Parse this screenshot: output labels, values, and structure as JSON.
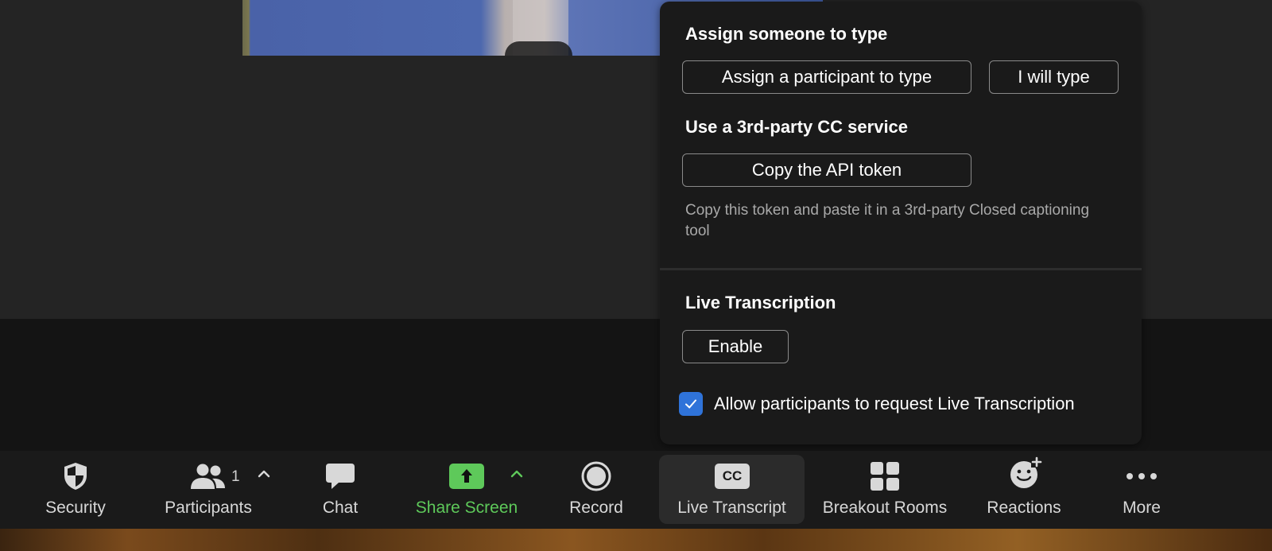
{
  "popover": {
    "assign_title": "Assign someone to type",
    "assign_participant_btn": "Assign a participant to type",
    "i_will_type_btn": "I will type",
    "third_party_title": "Use a 3rd-party CC service",
    "copy_token_btn": "Copy the API token",
    "copy_token_hint": "Copy this token and paste it in a 3rd-party Closed captioning tool",
    "live_title": "Live Transcription",
    "enable_btn": "Enable",
    "allow_request_label": "Allow participants to request Live Transcription",
    "allow_request_checked": true
  },
  "toolbar": {
    "security": "Security",
    "participants": "Participants",
    "participants_count": "1",
    "chat": "Chat",
    "share_screen": "Share Screen",
    "record": "Record",
    "live_transcript": "Live Transcript",
    "cc_badge": "CC",
    "breakout_rooms": "Breakout Rooms",
    "reactions": "Reactions",
    "more": "More"
  },
  "colors": {
    "share_green": "#5ec95a",
    "checkbox_blue": "#2f73d9",
    "toolbar_bg": "#1a1a1a",
    "popover_bg": "#1a1a1a"
  }
}
